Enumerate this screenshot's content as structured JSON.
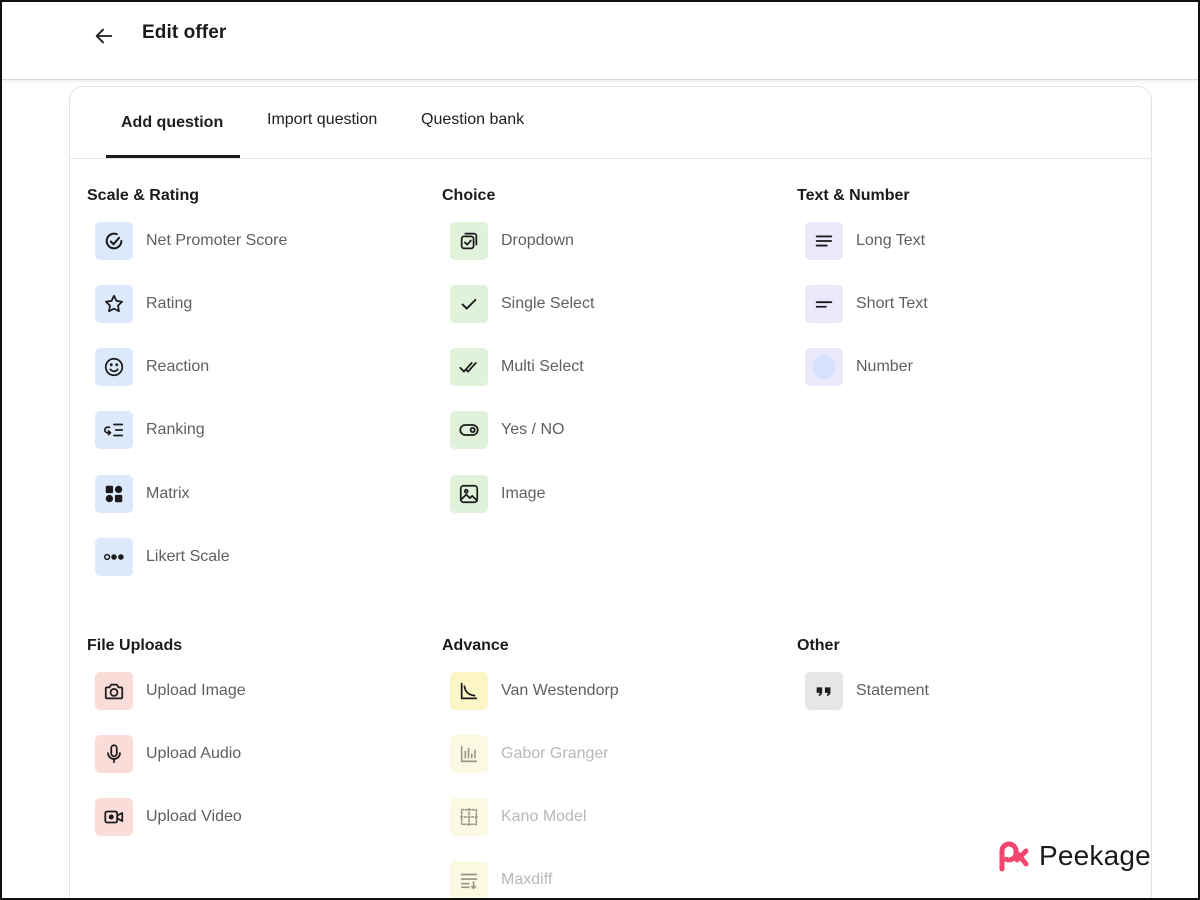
{
  "header": {
    "title": "Edit offer"
  },
  "tabs": [
    {
      "label": "Add question"
    },
    {
      "label": "Import question"
    },
    {
      "label": "Question bank"
    }
  ],
  "sections": {
    "scale_rating": {
      "title": "Scale & Rating",
      "items": [
        {
          "label": "Net Promoter Score",
          "icon": "nps-gauge-icon"
        },
        {
          "label": "Rating",
          "icon": "star-icon"
        },
        {
          "label": "Reaction",
          "icon": "smiley-icon"
        },
        {
          "label": "Ranking",
          "icon": "ranking-icon"
        },
        {
          "label": "Matrix",
          "icon": "matrix-grid-icon"
        },
        {
          "label": "Likert Scale",
          "icon": "likert-dots-icon"
        }
      ]
    },
    "choice": {
      "title": "Choice",
      "items": [
        {
          "label": "Dropdown",
          "icon": "dropdown-check-icon"
        },
        {
          "label": "Single Select",
          "icon": "check-icon"
        },
        {
          "label": "Multi Select",
          "icon": "double-check-icon"
        },
        {
          "label": "Yes / NO",
          "icon": "toggle-icon"
        },
        {
          "label": "Image",
          "icon": "image-icon"
        }
      ]
    },
    "text_number": {
      "title": "Text & Number",
      "items": [
        {
          "label": "Long Text",
          "icon": "long-text-icon"
        },
        {
          "label": "Short Text",
          "icon": "short-text-icon"
        },
        {
          "label": "Number",
          "icon": "number-icon"
        }
      ]
    },
    "file_uploads": {
      "title": "File Uploads",
      "items": [
        {
          "label": "Upload Image",
          "icon": "camera-icon"
        },
        {
          "label": "Upload Audio",
          "icon": "microphone-icon"
        },
        {
          "label": "Upload Video",
          "icon": "video-camera-icon"
        }
      ]
    },
    "advance": {
      "title": "Advance",
      "items": [
        {
          "label": "Van Westendorp",
          "icon": "curve-chart-icon"
        },
        {
          "label": "Gabor Granger",
          "icon": "bar-chart-icon"
        },
        {
          "label": "Kano Model",
          "icon": "kano-grid-icon"
        },
        {
          "label": "Maxdiff",
          "icon": "sort-list-icon"
        }
      ]
    },
    "other": {
      "title": "Other",
      "items": [
        {
          "label": "Statement",
          "icon": "quote-icon"
        }
      ]
    }
  },
  "brand": {
    "name": "Peekage",
    "accent": "#f2466e"
  },
  "colors": {
    "scale_rating_bg": "#dbe9fb",
    "choice_bg": "#e1f2da",
    "text_number_bg": "#ebe8fb",
    "file_uploads_bg": "#fadcd9",
    "advance_bg": "#fcf5c6",
    "other_bg": "#e6e6e6"
  }
}
